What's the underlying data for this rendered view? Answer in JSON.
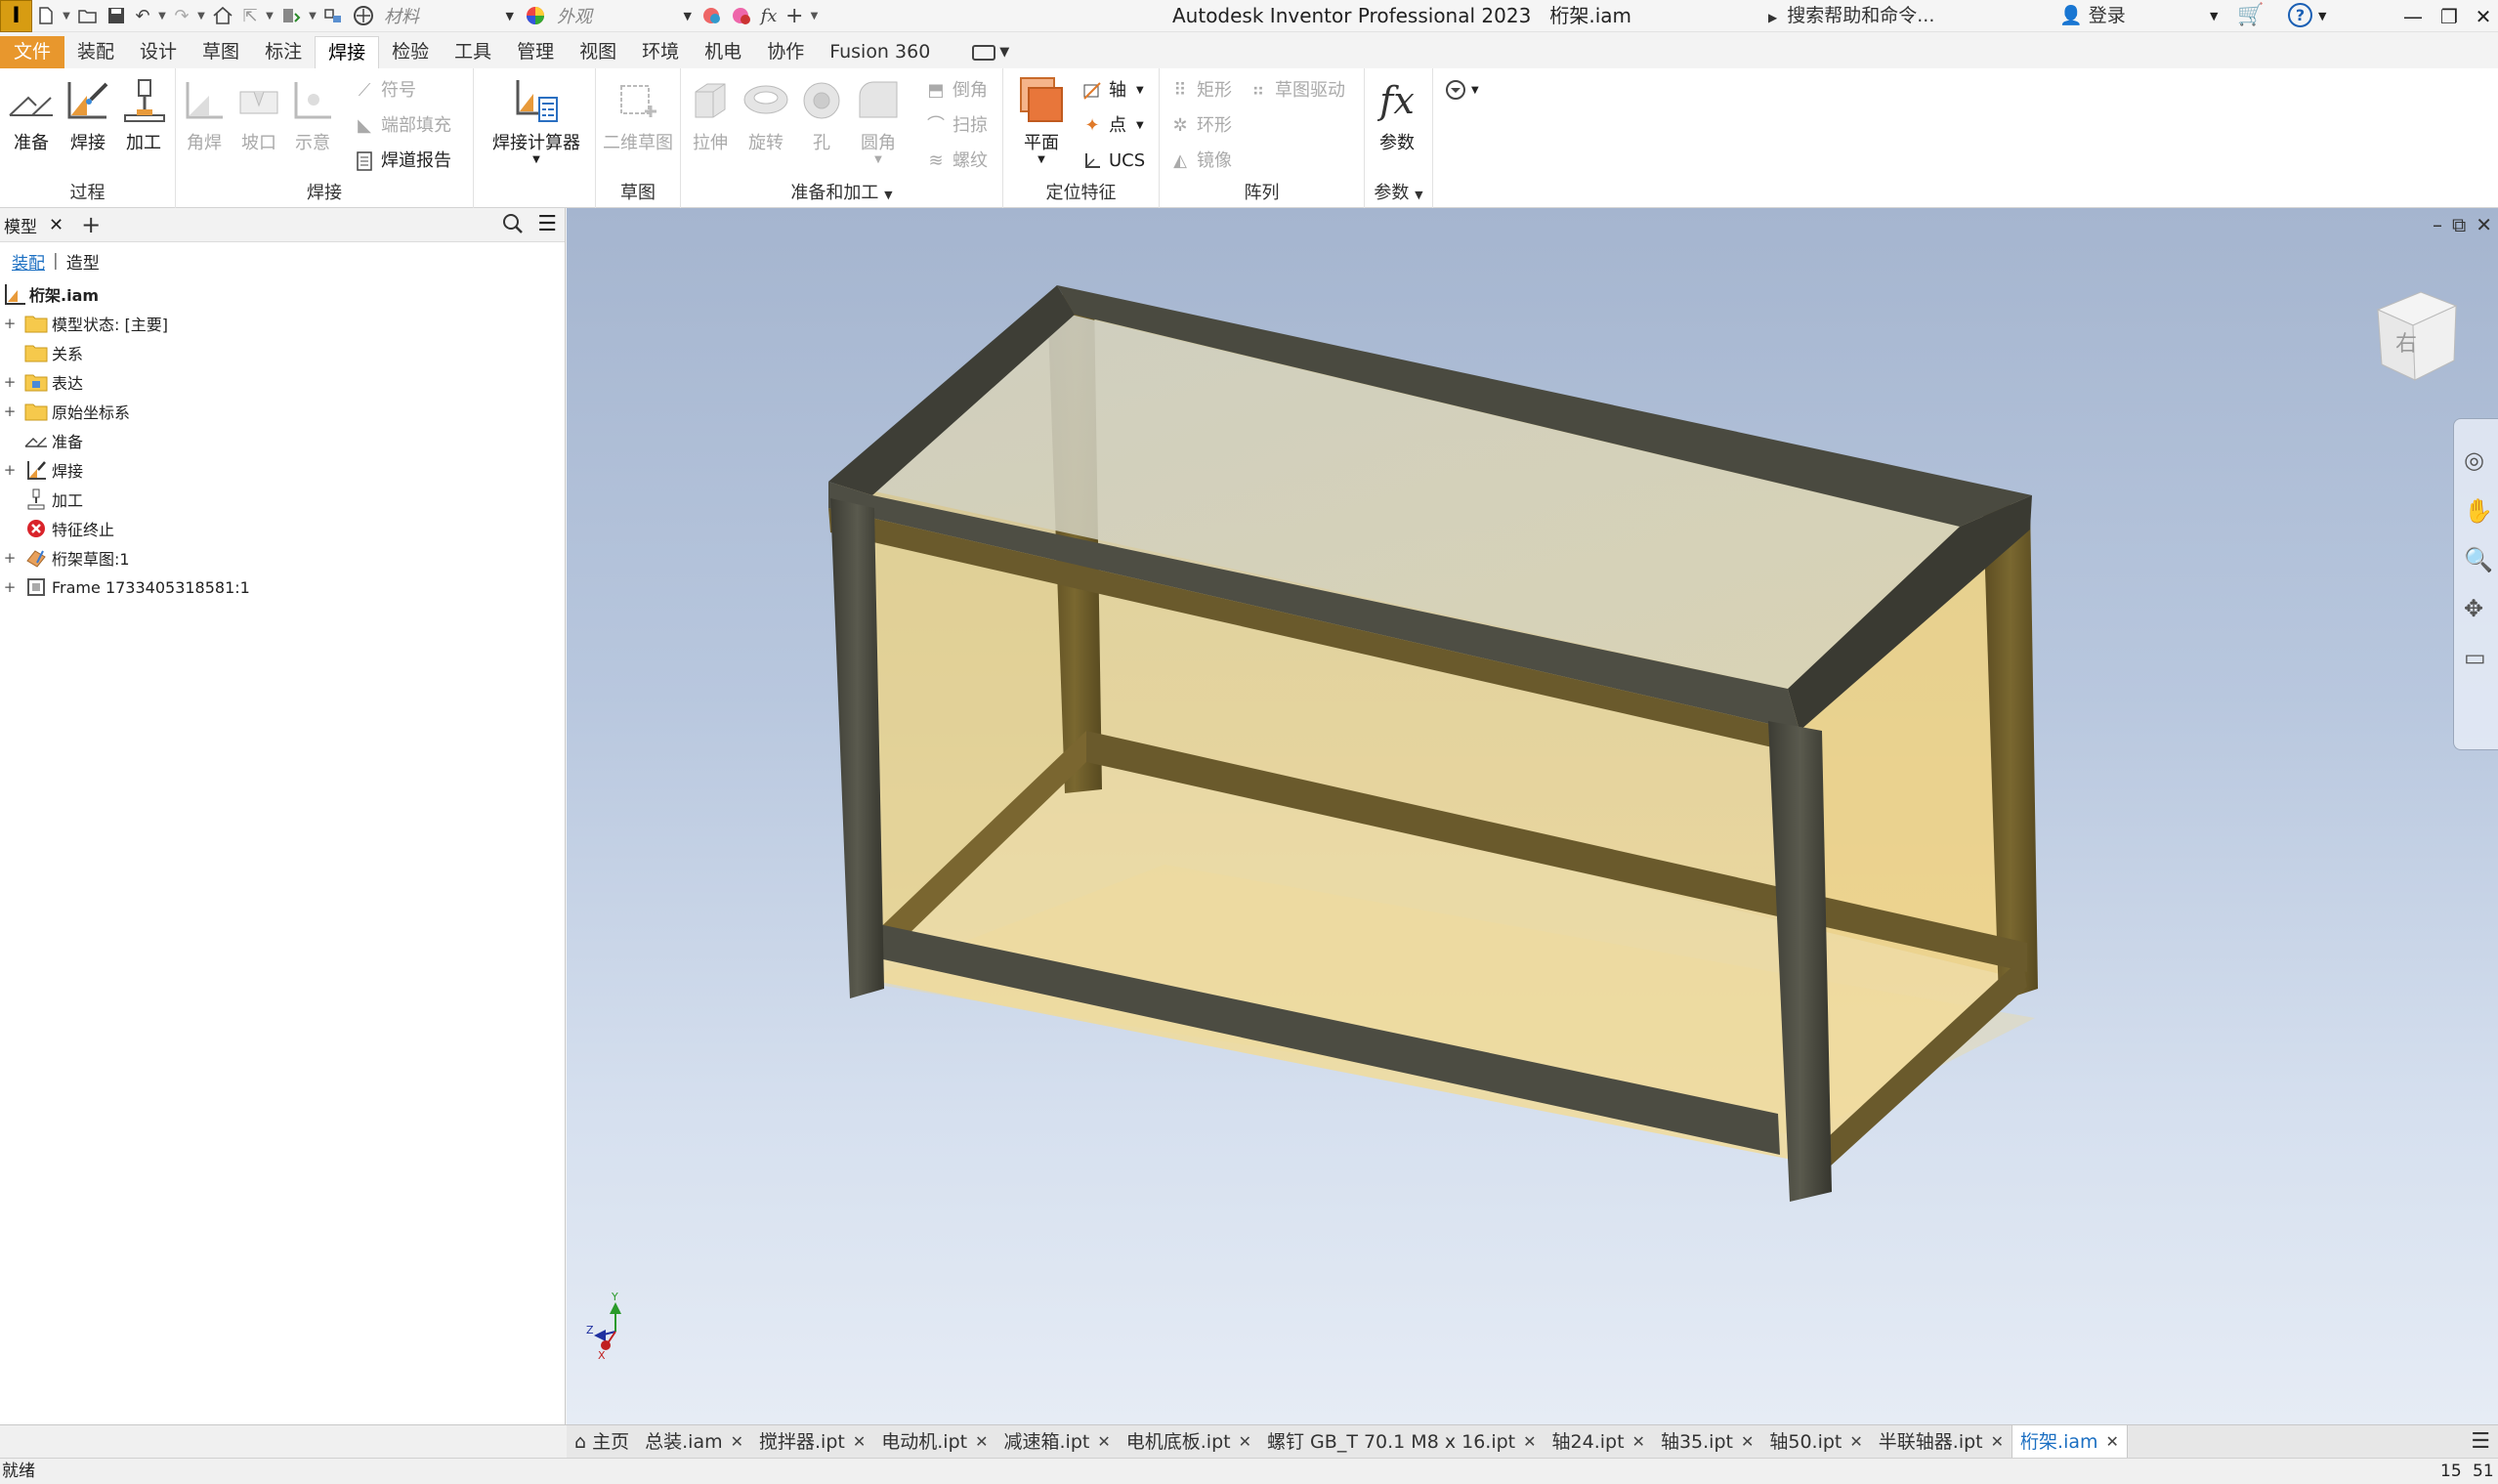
{
  "titlebar": {
    "app_title": "Autodesk Inventor Professional 2023",
    "document": "桁架.iam",
    "material_placeholder": "材料",
    "appearance_placeholder": "外观",
    "search_help": "搜索帮助和命令...",
    "login": "登录"
  },
  "tabs": {
    "file": "文件",
    "assemble": "装配",
    "design": "设计",
    "sketch": "草图",
    "annotate": "标注",
    "weld": "焊接",
    "inspect": "检验",
    "tools": "工具",
    "manage": "管理",
    "view": "视图",
    "environments": "环境",
    "electromechanical": "机电",
    "collaborate": "协作",
    "fusion": "Fusion 360"
  },
  "ribbon": {
    "process": {
      "title": "过程",
      "prepare": "准备",
      "weld": "焊接",
      "machine": "加工"
    },
    "weld": {
      "title": "焊接",
      "fillet": "角焊",
      "groove": "坡口",
      "cosmetic": "示意",
      "symbol": "符号",
      "end_fill": "端部填充",
      "bead_report": "焊道报告",
      "calculator": "焊接计算器"
    },
    "sketch": {
      "title": "草图",
      "sketch2d": "二维草图"
    },
    "prep_machine": {
      "title": "准备和加工",
      "extrude": "拉伸",
      "revolve": "旋转",
      "hole": "孔",
      "fillet": "圆角",
      "chamfer": "倒角",
      "sweep": "扫掠",
      "thread": "螺纹"
    },
    "work_features": {
      "title": "定位特征",
      "plane": "平面",
      "axis": "轴",
      "point": "点",
      "ucs": "UCS"
    },
    "pattern": {
      "title": "阵列",
      "rect": "矩形",
      "circular": "环形",
      "mirror": "镜像",
      "sketch_driven": "草图驱动"
    },
    "params": {
      "title": "参数",
      "params": "参数"
    }
  },
  "browser": {
    "tab_label": "模型",
    "sub_assembly": "装配",
    "sub_modeling": "造型",
    "root": "桁架.iam",
    "items": [
      {
        "label": "模型状态: [主要]"
      },
      {
        "label": "关系"
      },
      {
        "label": "表达"
      },
      {
        "label": "原始坐标系"
      },
      {
        "label": "准备"
      },
      {
        "label": "焊接"
      },
      {
        "label": "加工"
      },
      {
        "label": "特征终止"
      },
      {
        "label": "桁架草图:1"
      },
      {
        "label": "Frame 1733405318581:1"
      }
    ]
  },
  "triad": {
    "x": "X",
    "y": "Y",
    "z": "Z"
  },
  "viewcube": {
    "face": "右"
  },
  "doc_tabs": {
    "home": "主页",
    "items": [
      "总装.iam",
      "搅拌器.ipt",
      "电动机.ipt",
      "减速箱.ipt",
      "电机底板.ipt",
      "螺钉 GB_T 70.1 M8 x 16.ipt",
      "轴24.ipt",
      "轴35.ipt",
      "轴50.ipt",
      "半联轴器.ipt",
      "桁架.iam"
    ]
  },
  "status": {
    "text": "就绪",
    "n1": "15",
    "n2": "51"
  },
  "colors": {
    "file_tab": "#e8972d",
    "accent": "#1b6fc2",
    "frame_steel": "#4a4a40",
    "glass": "#e8c860"
  }
}
